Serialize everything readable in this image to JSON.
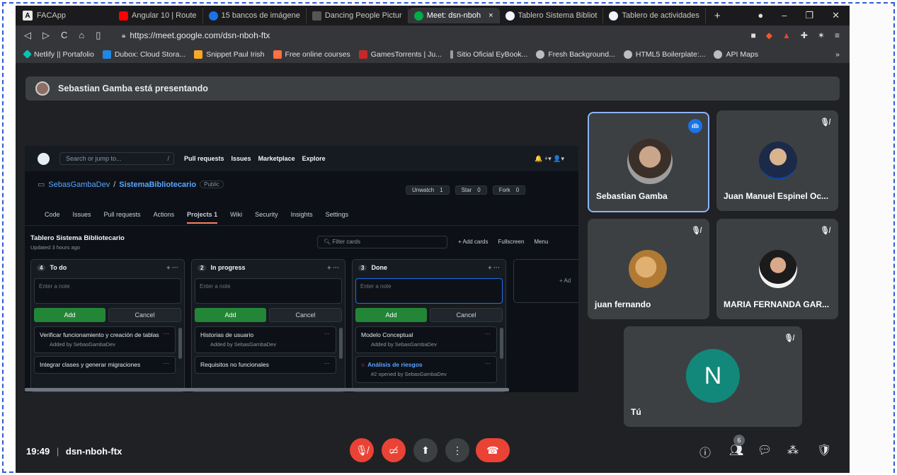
{
  "browser": {
    "app_title": "FACApp",
    "tabs": [
      {
        "label": "Angular 10 | Route",
        "color": "#ff0000"
      },
      {
        "label": "15 bancos de imágene",
        "color": "#1a73e8"
      },
      {
        "label": "Dancing People Pictur",
        "color": "#333333"
      },
      {
        "label": "Meet: dsn-nboh",
        "color": "#00ac47",
        "active": true
      },
      {
        "label": "Tablero Sistema Bibliot",
        "color": "#f0f6fc"
      },
      {
        "label": "Tablero de actividades",
        "color": "#f0f6fc"
      }
    ],
    "url": "https://meet.google.com/dsn-nboh-ftx",
    "bookmarks": [
      {
        "label": "Netlify || Portafolio",
        "color": "#00c7b7"
      },
      {
        "label": "Dubox: Cloud Stora...",
        "color": "#1e88e5"
      },
      {
        "label": "Snippet Paul Irish",
        "color": "#f9a825"
      },
      {
        "label": "Free online courses",
        "color": "#ff7043"
      },
      {
        "label": "GamesTorrents | Ju...",
        "color": "#c62828"
      },
      {
        "label": "Sitio Oficial EyBook...",
        "color": "#9e9e9e"
      },
      {
        "label": "Fresh Background...",
        "color": "#bdbdbd"
      },
      {
        "label": "HTML5 Boilerplate:...",
        "color": "#bdbdbd"
      },
      {
        "label": "API Maps",
        "color": "#bdbdbd"
      }
    ],
    "bookmarks_more": "»"
  },
  "meet": {
    "presenting_text": "Sebastian Gamba está presentando",
    "meeting_time": "19:49",
    "meeting_code": "dsn-nboh-ftx",
    "participant_count": "6",
    "you_initial": "N",
    "participants": [
      {
        "name": "Sebastian Gamba",
        "speaking": true
      },
      {
        "name": "Juan Manuel Espinel Oc...",
        "muted": true
      },
      {
        "name": "juan fernando",
        "muted": true
      },
      {
        "name": "MARIA FERNANDA GAR...",
        "muted": true
      },
      {
        "name": "Tú",
        "muted": true
      }
    ]
  },
  "github": {
    "search_placeholder": "Search or jump to...",
    "search_key": "/",
    "nav": [
      "Pull requests",
      "Issues",
      "Marketplace",
      "Explore"
    ],
    "header_right": "🔔 +▾ 👤▾",
    "owner": "SebasGambaDev",
    "repo": "SistemaBibliotecario",
    "visibility": "Public",
    "watch_label": "Unwatch",
    "watch_count": "1",
    "star_label": "Star",
    "star_count": "0",
    "fork_label": "Fork",
    "fork_count": "0",
    "repo_tabs": [
      "Code",
      "Issues",
      "Pull requests",
      "Actions",
      "Projects 1",
      "Wiki",
      "Security",
      "Insights",
      "Settings"
    ],
    "board_title": "Tablero Sistema Bibliotecario",
    "board_updated": "Updated 3 hours ago",
    "filter_placeholder": "Filter cards",
    "add_cards": "+ Add cards",
    "fullscreen": "Fullscreen",
    "menu": "Menu",
    "add_column": "+ Ad",
    "note_placeholder": "Enter a note",
    "add_label": "Add",
    "cancel_label": "Cancel",
    "columns": [
      {
        "title": "To do",
        "count": "4",
        "cards": [
          {
            "title": "Verificar funcionamiento y creación de tablas",
            "by": "Added by SebasGambaDev"
          },
          {
            "title": "Integrar clases y generar migraciones",
            "by": ""
          }
        ]
      },
      {
        "title": "In progress",
        "count": "2",
        "cards": [
          {
            "title": "Historias de usuario",
            "by": "Added by SebasGambaDev"
          },
          {
            "title": "Requisitos no funcionales",
            "by": ""
          }
        ]
      },
      {
        "title": "Done",
        "count": "3",
        "cards": [
          {
            "title": "Modelo Conceptual",
            "by": "Added by SebasGambaDev"
          },
          {
            "title": "Análisis de riesgos",
            "by": "#2 opened by SebasGambaDev",
            "issue": true
          }
        ]
      }
    ]
  }
}
